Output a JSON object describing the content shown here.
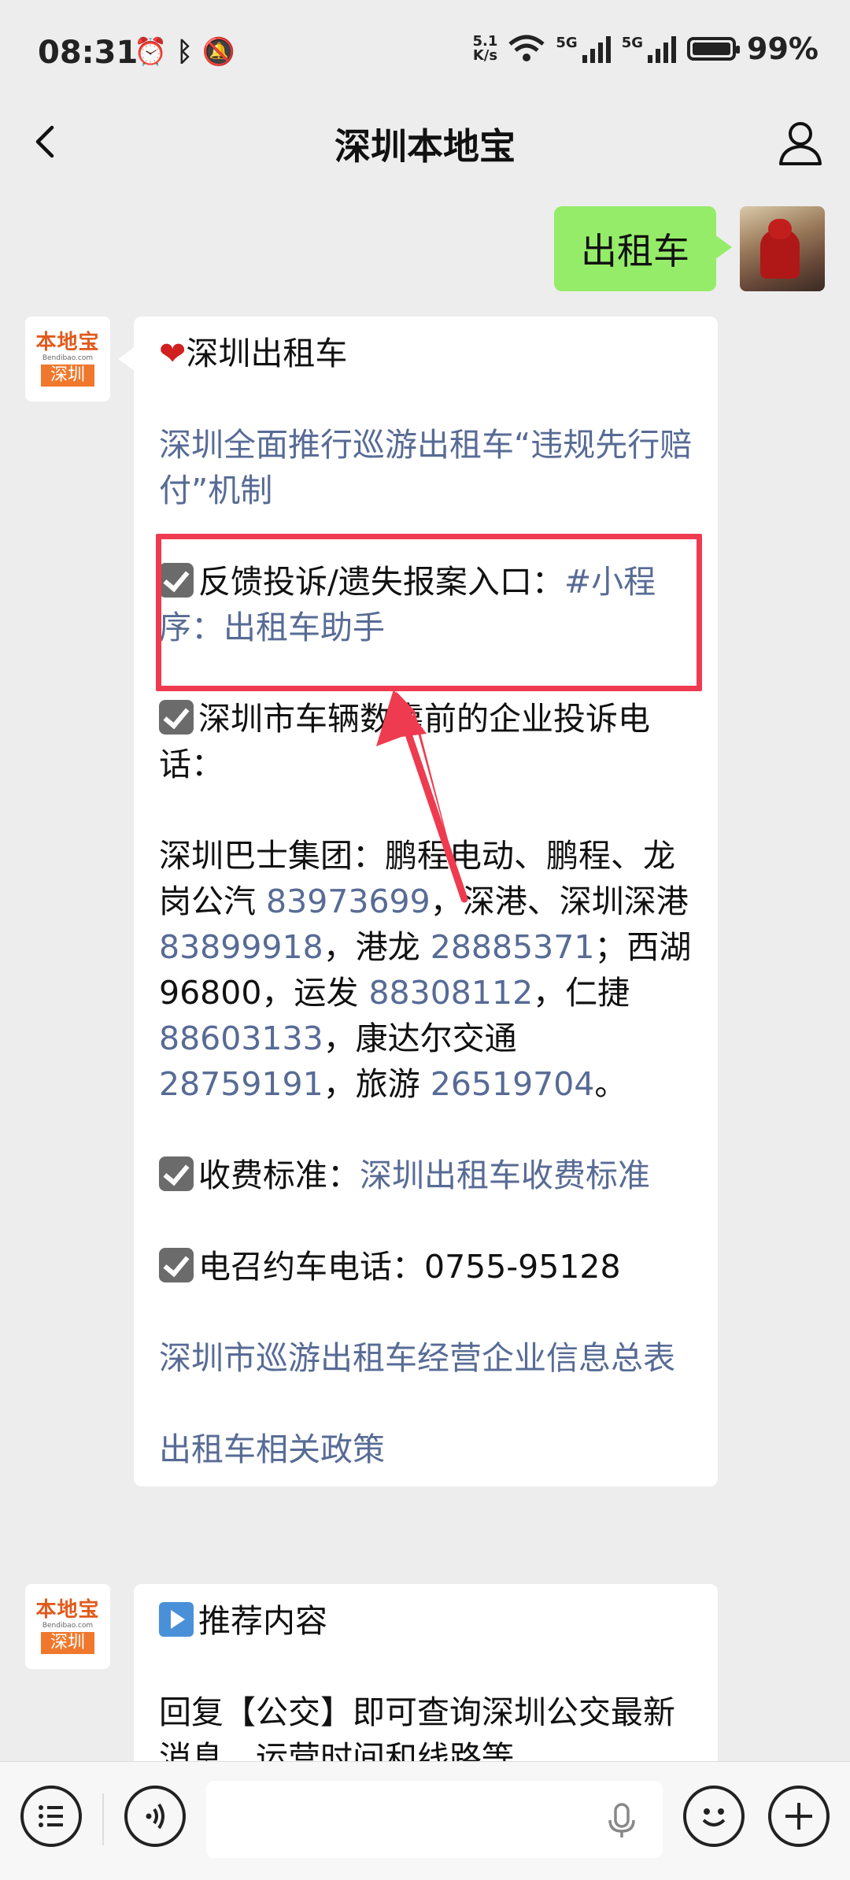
{
  "status_bar": {
    "time": "08:31",
    "speed_value": "5.1",
    "speed_unit": "K/s",
    "net1": "5G",
    "net2": "5G",
    "battery_pct": "99%"
  },
  "header": {
    "title": "深圳本地宝"
  },
  "user_message": {
    "text": "出租车"
  },
  "bot_avatar": {
    "line1": "本地宝",
    "line2": "Bendibao.com",
    "line3": "深圳"
  },
  "bot_message_1": {
    "heading": "深圳出租车",
    "link_policy": "深圳全面推行巡游出租车“违规先行赔付”机制",
    "feedback_label": "反馈投诉/遗失报案入口：",
    "feedback_link": "#小程序：出租车助手",
    "complaints_label": "深圳市车辆数靠前的企业投诉电话：",
    "phones": {
      "t1": "深圳巴士集团：鹏程电动、鹏程、龙岗公汽 ",
      "p1": "83973699",
      "t2": "，深港、深圳深港 ",
      "p2": "83899918",
      "t3": "，港龙 ",
      "p3": "28885371",
      "t4": "；西湖 96800，运发 ",
      "p4": "88308112",
      "t5": "，仁捷 ",
      "p5": "88603133",
      "t6": "，康达尔交通 ",
      "p6": "28759191",
      "t7": "，旅游 ",
      "p7": "26519704",
      "t8": "。"
    },
    "fare_label": "收费标准：",
    "fare_link": "深圳出租车收费标准",
    "call_label": "电召约车电话：0755-95128",
    "link_enterprise": "深圳市巡游出租车经营企业信息总表",
    "link_related": "出租车相关政策"
  },
  "bot_message_2": {
    "heading": "推荐内容",
    "body": "回复【公交】即可查询深圳公交最新消息，运营时间和线路等"
  },
  "colors": {
    "link": "#576b95",
    "my_bubble": "#95ec69",
    "highlight": "#ef3b4f"
  }
}
